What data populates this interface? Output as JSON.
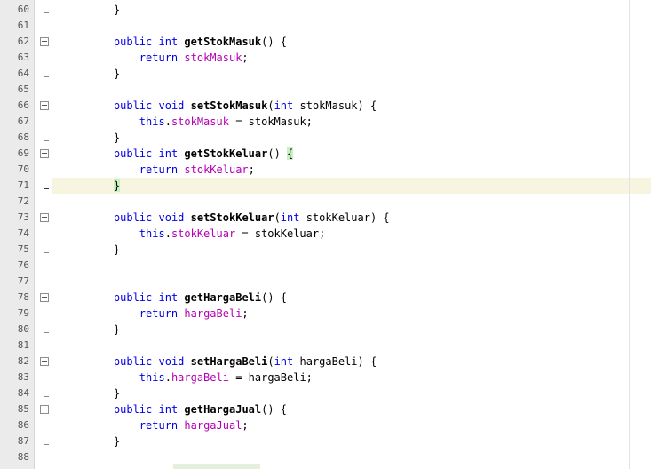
{
  "editor": {
    "lines": [
      {
        "n": "60",
        "tokens": [
          {
            "t": "    }",
            "c": ""
          }
        ],
        "fold": "end"
      },
      {
        "n": "61",
        "tokens": [],
        "fold": ""
      },
      {
        "n": "62",
        "tokens": [
          {
            "t": "    ",
            "c": ""
          },
          {
            "t": "public",
            "c": "kw"
          },
          {
            "t": " ",
            "c": ""
          },
          {
            "t": "int",
            "c": "kw"
          },
          {
            "t": " ",
            "c": ""
          },
          {
            "t": "getStokMasuk",
            "c": "fn"
          },
          {
            "t": "() {",
            "c": ""
          }
        ],
        "fold": "start"
      },
      {
        "n": "63",
        "tokens": [
          {
            "t": "        ",
            "c": ""
          },
          {
            "t": "return",
            "c": "kw"
          },
          {
            "t": " ",
            "c": ""
          },
          {
            "t": "stokMasuk",
            "c": "fld"
          },
          {
            "t": ";",
            "c": ""
          }
        ],
        "fold": "mid"
      },
      {
        "n": "64",
        "tokens": [
          {
            "t": "    }",
            "c": ""
          }
        ],
        "fold": "end"
      },
      {
        "n": "65",
        "tokens": [],
        "fold": ""
      },
      {
        "n": "66",
        "tokens": [
          {
            "t": "    ",
            "c": ""
          },
          {
            "t": "public",
            "c": "kw"
          },
          {
            "t": " ",
            "c": ""
          },
          {
            "t": "void",
            "c": "kw"
          },
          {
            "t": " ",
            "c": ""
          },
          {
            "t": "setStokMasuk",
            "c": "fn"
          },
          {
            "t": "(",
            "c": ""
          },
          {
            "t": "int",
            "c": "kw"
          },
          {
            "t": " stokMasuk) {",
            "c": ""
          }
        ],
        "fold": "start"
      },
      {
        "n": "67",
        "tokens": [
          {
            "t": "        ",
            "c": ""
          },
          {
            "t": "this",
            "c": "kw"
          },
          {
            "t": ".",
            "c": ""
          },
          {
            "t": "stokMasuk",
            "c": "fld"
          },
          {
            "t": " = stokMasuk;",
            "c": ""
          }
        ],
        "fold": "mid"
      },
      {
        "n": "68",
        "tokens": [
          {
            "t": "    }",
            "c": ""
          }
        ],
        "fold": "end"
      },
      {
        "n": "69",
        "tokens": [
          {
            "t": "    ",
            "c": ""
          },
          {
            "t": "public",
            "c": "kw"
          },
          {
            "t": " ",
            "c": ""
          },
          {
            "t": "int",
            "c": "kw"
          },
          {
            "t": " ",
            "c": ""
          },
          {
            "t": "getStokKeluar",
            "c": "fn"
          },
          {
            "t": "() ",
            "c": ""
          },
          {
            "t": "{",
            "c": "brace-match"
          }
        ],
        "fold": "start-active"
      },
      {
        "n": "70",
        "tokens": [
          {
            "t": "        ",
            "c": ""
          },
          {
            "t": "return",
            "c": "kw"
          },
          {
            "t": " ",
            "c": ""
          },
          {
            "t": "stokKeluar",
            "c": "fld"
          },
          {
            "t": ";",
            "c": ""
          }
        ],
        "fold": "mid-active"
      },
      {
        "n": "71",
        "tokens": [
          {
            "t": "    ",
            "c": ""
          },
          {
            "t": "}",
            "c": "brace-match"
          }
        ],
        "fold": "end-active",
        "current": true
      },
      {
        "n": "72",
        "tokens": [],
        "fold": ""
      },
      {
        "n": "73",
        "tokens": [
          {
            "t": "    ",
            "c": ""
          },
          {
            "t": "public",
            "c": "kw"
          },
          {
            "t": " ",
            "c": ""
          },
          {
            "t": "void",
            "c": "kw"
          },
          {
            "t": " ",
            "c": ""
          },
          {
            "t": "setStokKeluar",
            "c": "fn"
          },
          {
            "t": "(",
            "c": ""
          },
          {
            "t": "int",
            "c": "kw"
          },
          {
            "t": " stokKeluar) {",
            "c": ""
          }
        ],
        "fold": "start"
      },
      {
        "n": "74",
        "tokens": [
          {
            "t": "        ",
            "c": ""
          },
          {
            "t": "this",
            "c": "kw"
          },
          {
            "t": ".",
            "c": ""
          },
          {
            "t": "stokKeluar",
            "c": "fld"
          },
          {
            "t": " = stokKeluar;",
            "c": ""
          }
        ],
        "fold": "mid"
      },
      {
        "n": "75",
        "tokens": [
          {
            "t": "    }",
            "c": ""
          }
        ],
        "fold": "end"
      },
      {
        "n": "76",
        "tokens": [],
        "fold": ""
      },
      {
        "n": "77",
        "tokens": [],
        "fold": ""
      },
      {
        "n": "78",
        "tokens": [
          {
            "t": "    ",
            "c": ""
          },
          {
            "t": "public",
            "c": "kw"
          },
          {
            "t": " ",
            "c": ""
          },
          {
            "t": "int",
            "c": "kw"
          },
          {
            "t": " ",
            "c": ""
          },
          {
            "t": "getHargaBeli",
            "c": "fn"
          },
          {
            "t": "() {",
            "c": ""
          }
        ],
        "fold": "start"
      },
      {
        "n": "79",
        "tokens": [
          {
            "t": "        ",
            "c": ""
          },
          {
            "t": "return",
            "c": "kw"
          },
          {
            "t": " ",
            "c": ""
          },
          {
            "t": "hargaBeli",
            "c": "fld"
          },
          {
            "t": ";",
            "c": ""
          }
        ],
        "fold": "mid"
      },
      {
        "n": "80",
        "tokens": [
          {
            "t": "    }",
            "c": ""
          }
        ],
        "fold": "end"
      },
      {
        "n": "81",
        "tokens": [],
        "fold": ""
      },
      {
        "n": "82",
        "tokens": [
          {
            "t": "    ",
            "c": ""
          },
          {
            "t": "public",
            "c": "kw"
          },
          {
            "t": " ",
            "c": ""
          },
          {
            "t": "void",
            "c": "kw"
          },
          {
            "t": " ",
            "c": ""
          },
          {
            "t": "setHargaBeli",
            "c": "fn"
          },
          {
            "t": "(",
            "c": ""
          },
          {
            "t": "int",
            "c": "kw"
          },
          {
            "t": " hargaBeli) {",
            "c": ""
          }
        ],
        "fold": "start"
      },
      {
        "n": "83",
        "tokens": [
          {
            "t": "        ",
            "c": ""
          },
          {
            "t": "this",
            "c": "kw"
          },
          {
            "t": ".",
            "c": ""
          },
          {
            "t": "hargaBeli",
            "c": "fld"
          },
          {
            "t": " = hargaBeli;",
            "c": ""
          }
        ],
        "fold": "mid"
      },
      {
        "n": "84",
        "tokens": [
          {
            "t": "    }",
            "c": ""
          }
        ],
        "fold": "end"
      },
      {
        "n": "85",
        "tokens": [
          {
            "t": "    ",
            "c": ""
          },
          {
            "t": "public",
            "c": "kw"
          },
          {
            "t": " ",
            "c": ""
          },
          {
            "t": "int",
            "c": "kw"
          },
          {
            "t": " ",
            "c": ""
          },
          {
            "t": "getHargaJual",
            "c": "fn"
          },
          {
            "t": "() {",
            "c": ""
          }
        ],
        "fold": "start"
      },
      {
        "n": "86",
        "tokens": [
          {
            "t": "        ",
            "c": ""
          },
          {
            "t": "return",
            "c": "kw"
          },
          {
            "t": " ",
            "c": ""
          },
          {
            "t": "hargaJual",
            "c": "fld"
          },
          {
            "t": ";",
            "c": ""
          }
        ],
        "fold": "mid"
      },
      {
        "n": "87",
        "tokens": [
          {
            "t": "    }",
            "c": ""
          }
        ],
        "fold": "end"
      },
      {
        "n": "88",
        "tokens": [],
        "fold": ""
      }
    ]
  },
  "colors": {
    "keyword": "#0000e6",
    "field": "#b400b4",
    "current_line": "#f7f4e0",
    "brace_match": "#c8f0c0",
    "gutter": "#ebebeb"
  }
}
